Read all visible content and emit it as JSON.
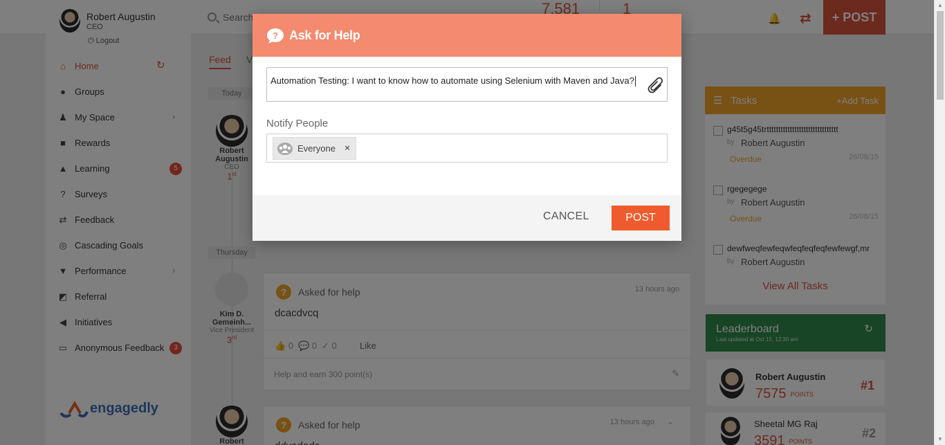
{
  "topbar": {
    "user_name": "Robert Augustin",
    "user_role": "CEO",
    "logout_label": "Logout",
    "search_placeholder": "Search",
    "stat_one": "7,581",
    "stat_two": "1",
    "post_button_label": "+ POST"
  },
  "sidebar": {
    "items": [
      {
        "label": "Home",
        "icon": "home-icon"
      },
      {
        "label": "Groups",
        "icon": "groups-icon"
      },
      {
        "label": "My Space",
        "icon": "person-icon"
      },
      {
        "label": "Rewards",
        "icon": "gift-icon"
      },
      {
        "label": "Learning",
        "icon": "learning-icon",
        "badge": "5"
      },
      {
        "label": "Surveys",
        "icon": "question-circle-icon"
      },
      {
        "label": "Feedback",
        "icon": "arrows-icon"
      },
      {
        "label": "Cascading Goals",
        "icon": "target-icon"
      },
      {
        "label": "Performance",
        "icon": "trophy-icon"
      },
      {
        "label": "Referral",
        "icon": "referral-icon"
      },
      {
        "label": "Initiatives",
        "icon": "megaphone-icon"
      },
      {
        "label": "Anonymous Feedback",
        "icon": "inbox-icon",
        "badge": "3"
      }
    ],
    "logo_text": "engagedly"
  },
  "feed": {
    "tab_feed": "Feed",
    "tab_second": "V",
    "day_today": "Today",
    "day_thursday": "Thursday",
    "author1": {
      "name": "Robert Augustin",
      "role": "CEO",
      "rank": "1",
      "rank_suffix": "st"
    },
    "author2": {
      "name": "Kim D. Gemeinh...",
      "role": "Vice President",
      "rank": "3",
      "rank_suffix": "rd"
    },
    "author3": {
      "name": "Robert"
    },
    "post1": {
      "type": "Asked for help",
      "time": "13 hours ago",
      "text": "dcacdvcq",
      "likes": "0",
      "comments": "0",
      "checks": "0",
      "like_label": "Like",
      "help_text": "Help and earn 300 point(s)"
    },
    "post2": {
      "type": "Asked for help",
      "time": "13 hours ago",
      "text": "ddvadada"
    }
  },
  "tasks": {
    "title": "Tasks",
    "add_label": "+Add Task",
    "by_label": "by",
    "items": [
      {
        "title": "g45t5g45trttttttttttttttttttttttttttttttt",
        "owner": "Robert Augustin",
        "status": "Overdue",
        "date": "26/08/15"
      },
      {
        "title": "rgegegege",
        "owner": "Robert Augustin",
        "status": "Overdue",
        "date": "26/08/15"
      },
      {
        "title": "dewfweqfewfeqwfeqfeqfeqfewfewgf,mr",
        "owner": "Robert Augustin",
        "status": "",
        "date": ""
      }
    ],
    "view_all_label": "View All Tasks"
  },
  "leaderboard": {
    "title": "Leaderboard",
    "subtitle": "Last updated at Oct 15, 12:30 am",
    "points_label": "POINTS",
    "rows": [
      {
        "name": "Robert Augustin",
        "points": "7575",
        "rank": "#1"
      },
      {
        "name": "Sheetal MG Raj",
        "points": "3591",
        "rank": "#2"
      }
    ]
  },
  "modal": {
    "title": "Ask for Help",
    "question_value": "Automation Testing: I want to know how to automate using Selenium with Maven and Java?",
    "notify_label": "Notify People",
    "chip_label": "Everyone",
    "chip_remove": "×",
    "cancel_label": "CANCEL",
    "post_label": "POST"
  },
  "colors": {
    "accent": "#d9533a",
    "modal_header": "#f48a6e",
    "post_button": "#ef5b2e",
    "tasks_header": "#f0a32b",
    "leaderboard_header": "#2e8b4a"
  }
}
